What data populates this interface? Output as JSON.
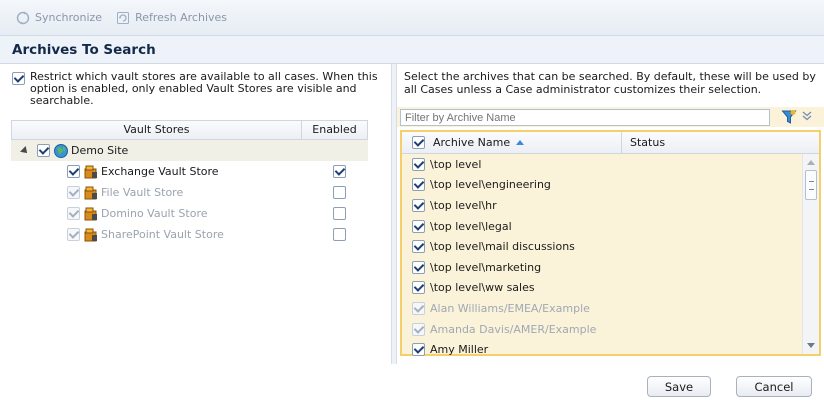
{
  "toolbar": {
    "synchronize_label": "Synchronize",
    "synchronize_icon": "synchronize-icon",
    "refresh_label": "Refresh Archives",
    "refresh_icon": "refresh-icon"
  },
  "title": "Archives To Search",
  "left": {
    "restrict_checked": true,
    "restrict_text": "Restrict which vault stores are available to all cases. When this option is enabled, only enabled Vault Stores are visible and searchable.",
    "columns": {
      "name": "Vault Stores",
      "enabled": "Enabled"
    },
    "site": {
      "label": "Demo Site",
      "checked": true,
      "icon": "globe-icon"
    },
    "stores": [
      {
        "label": "Exchange Vault Store",
        "checked": true,
        "enabled": true,
        "disabled": false,
        "icon": "vault-store-icon"
      },
      {
        "label": "File Vault Store",
        "checked": true,
        "enabled": false,
        "disabled": true,
        "icon": "vault-store-icon"
      },
      {
        "label": "Domino Vault Store",
        "checked": true,
        "enabled": false,
        "disabled": true,
        "icon": "vault-store-icon"
      },
      {
        "label": "SharePoint Vault Store",
        "checked": true,
        "enabled": false,
        "disabled": true,
        "icon": "vault-store-icon"
      }
    ]
  },
  "right": {
    "description": "Select the archives that can be searched. By default, these will be used by all Cases unless a Case administrator customizes their selection.",
    "filter_placeholder": "Filter by Archive Name",
    "columns": {
      "name": "Archive Name",
      "status": "Status"
    },
    "archives": [
      {
        "label": "\\top level",
        "checked": true,
        "disabled": false
      },
      {
        "label": "\\top level\\engineering",
        "checked": true,
        "disabled": false
      },
      {
        "label": "\\top level\\hr",
        "checked": true,
        "disabled": false
      },
      {
        "label": "\\top level\\legal",
        "checked": true,
        "disabled": false
      },
      {
        "label": "\\top level\\mail discussions",
        "checked": true,
        "disabled": false
      },
      {
        "label": "\\top level\\marketing",
        "checked": true,
        "disabled": false
      },
      {
        "label": "\\top level\\ww sales",
        "checked": true,
        "disabled": false
      },
      {
        "label": "Alan Williams/EMEA/Example",
        "checked": true,
        "disabled": true
      },
      {
        "label": "Amanda Davis/AMER/Example",
        "checked": true,
        "disabled": true
      },
      {
        "label": "Amy Miller",
        "checked": true,
        "disabled": false
      }
    ]
  },
  "footer": {
    "save_label": "Save",
    "cancel_label": "Cancel"
  },
  "colors": {
    "accent_border": "#f4cf6a",
    "row_bg": "#fbf3d9",
    "title": "#142a4a"
  }
}
